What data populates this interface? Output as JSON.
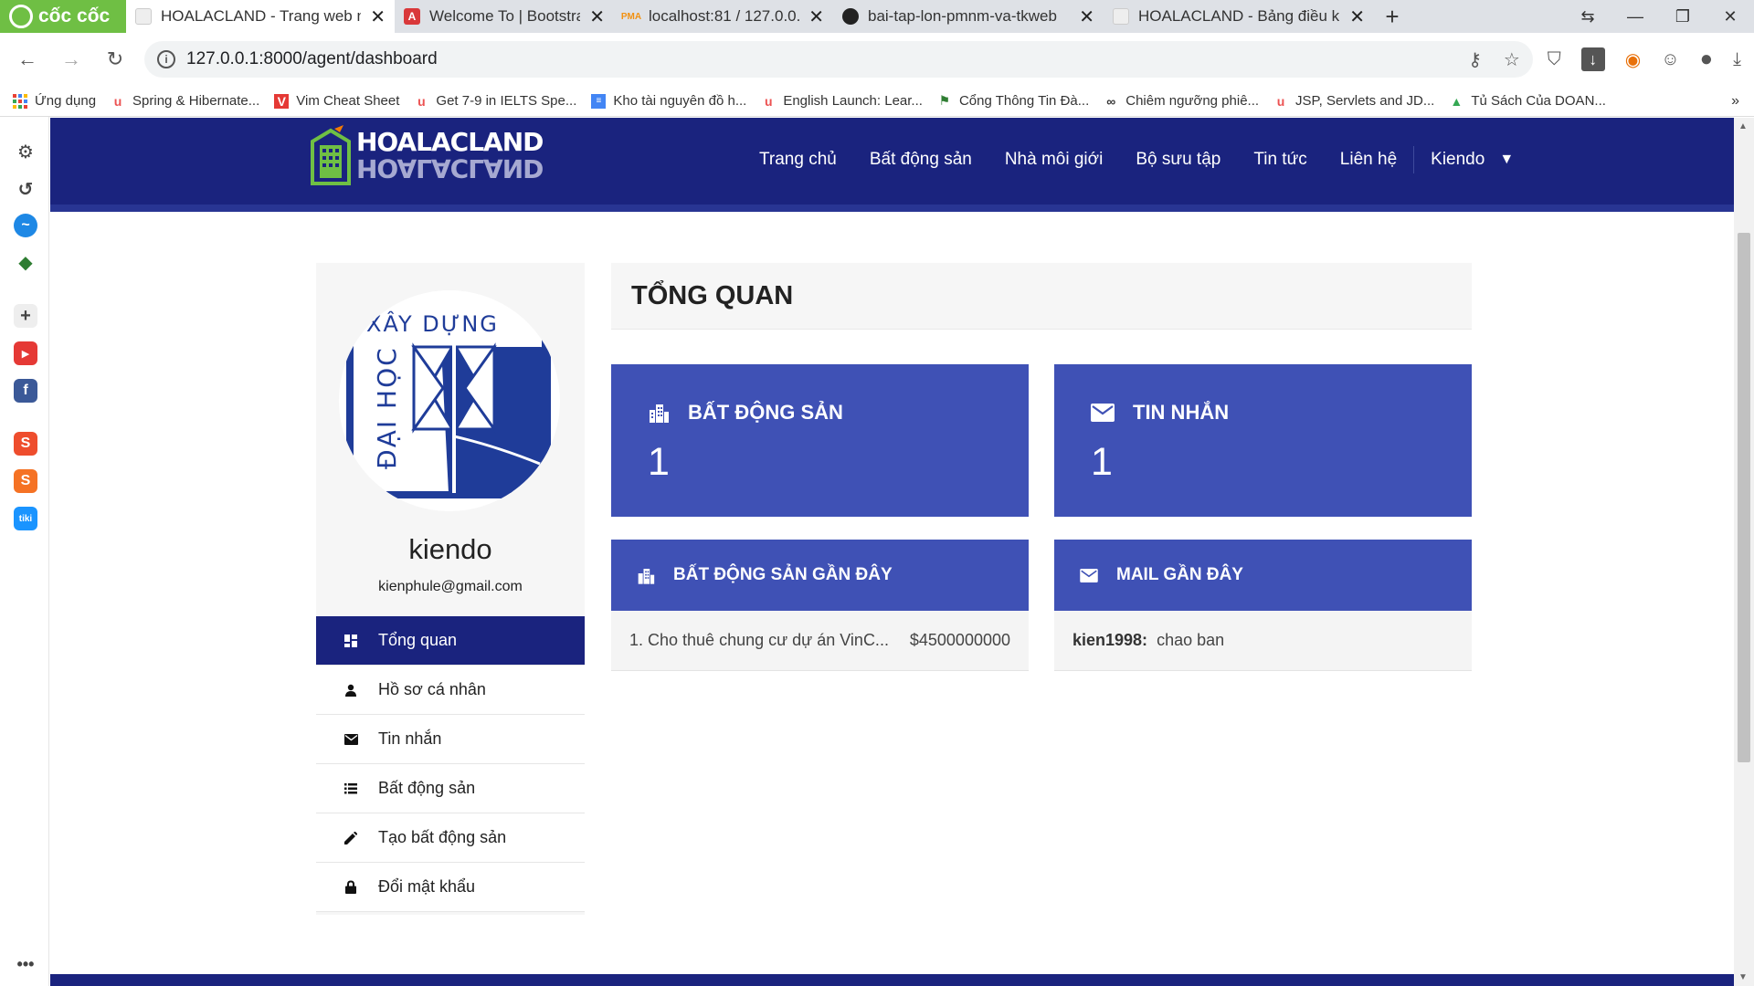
{
  "browser": {
    "brand": "cốc cốc",
    "tabs": [
      {
        "title": "HOALACLAND - Trang web n",
        "active": true
      },
      {
        "title": "Welcome To | Bootstrap Base",
        "active": false
      },
      {
        "title": "localhost:81 / 127.0.0.1 / hoa",
        "active": false
      },
      {
        "title": "bai-tap-lon-pmnm-va-tkweb",
        "active": false
      },
      {
        "title": "HOALACLAND - Bảng điều kh",
        "active": false
      }
    ],
    "url": "127.0.0.1:8000/agent/dashboard",
    "bookmarks": [
      {
        "label": "Ứng dụng",
        "icon": "apps-grid-icon"
      },
      {
        "label": "Spring & Hibernate...",
        "icon": "udemy-icon"
      },
      {
        "label": "Vim Cheat Sheet",
        "icon": "vim-icon"
      },
      {
        "label": "Get 7-9 in IELTS Spe...",
        "icon": "udemy-icon"
      },
      {
        "label": "Kho tài nguyên đồ h...",
        "icon": "docs-icon"
      },
      {
        "label": "English Launch: Lear...",
        "icon": "udemy-icon"
      },
      {
        "label": "Cổng Thông Tin Đà...",
        "icon": "portal-icon"
      },
      {
        "label": "Chiêm ngưỡng phiê...",
        "icon": "link-icon"
      },
      {
        "label": "JSP, Servlets and JD...",
        "icon": "udemy-icon"
      },
      {
        "label": "Tủ Sách Của DOAN...",
        "icon": "drive-icon"
      }
    ],
    "bookmarks_more": "»"
  },
  "site": {
    "logo_text": "HOALACLAND",
    "nav": [
      "Trang chủ",
      "Bất động sản",
      "Nhà môi giới",
      "Bộ sưu tập",
      "Tin tức",
      "Liên hệ"
    ],
    "user_menu": "Kiendo"
  },
  "profile": {
    "avatar_top_text": "XÂY DỰNG",
    "avatar_side_text": "ĐẠI HỌC",
    "name": "kiendo",
    "email": "kienphule@gmail.com",
    "menu": [
      {
        "label": "Tổng quan",
        "icon": "dashboard-icon",
        "active": true
      },
      {
        "label": "Hồ sơ cá nhân",
        "icon": "person-icon",
        "active": false
      },
      {
        "label": "Tin nhắn",
        "icon": "mail-icon",
        "active": false
      },
      {
        "label": "Bất động sản",
        "icon": "list-icon",
        "active": false
      },
      {
        "label": "Tạo bất động sản",
        "icon": "pencil-icon",
        "active": false
      },
      {
        "label": "Đổi mật khẩu",
        "icon": "lock-icon",
        "active": false
      }
    ]
  },
  "main": {
    "title": "TỔNG QUAN",
    "stats": [
      {
        "label": "BẤT ĐỘNG SẢN",
        "value": "1",
        "icon": "building-icon"
      },
      {
        "label": "TIN NHẮN",
        "value": "1",
        "icon": "mail-icon"
      }
    ],
    "recent_properties": {
      "title": "BẤT ĐỘNG SẢN GẦN ĐÂY",
      "items": [
        {
          "title": "1. Cho thuê chung cư dự án VinC...",
          "price": "$4500000000"
        }
      ]
    },
    "recent_mail": {
      "title": "MAIL GẦN ĐÂY",
      "items": [
        {
          "sender": "kien1998:",
          "message": "chao ban"
        }
      ]
    }
  },
  "colors": {
    "header": "#1a237e",
    "card": "#3f51b5",
    "brand_green": "#6fbf44"
  }
}
